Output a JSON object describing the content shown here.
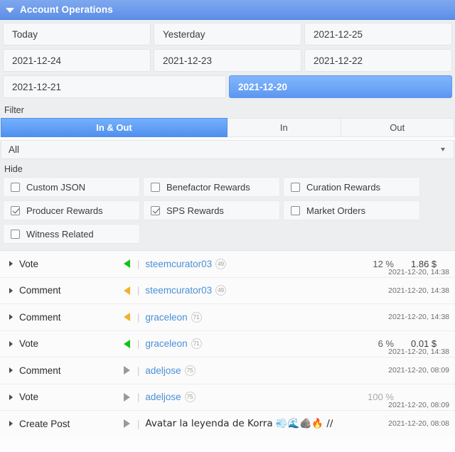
{
  "header": {
    "title": "Account Operations",
    "caret_icon": "caret-down-icon",
    "bg_color": "#6e9cec"
  },
  "dates": {
    "rows": [
      [
        {
          "label": "Today",
          "selected": false
        },
        {
          "label": "Yesterday",
          "selected": false
        },
        {
          "label": "2021-12-25",
          "selected": false
        }
      ],
      [
        {
          "label": "2021-12-24",
          "selected": false
        },
        {
          "label": "2021-12-23",
          "selected": false
        },
        {
          "label": "2021-12-22",
          "selected": false
        }
      ],
      [
        {
          "label": "2021-12-21",
          "selected": false
        },
        {
          "label": "2021-12-20",
          "selected": true
        }
      ]
    ]
  },
  "filter": {
    "label": "Filter",
    "segments": [
      {
        "label": "In & Out",
        "active": true
      },
      {
        "label": "In",
        "active": false
      },
      {
        "label": "Out",
        "active": false
      }
    ],
    "select": {
      "value": "All",
      "arrow_icon": "caret-down-icon"
    }
  },
  "hide": {
    "label": "Hide",
    "options": [
      {
        "label": "Custom JSON",
        "checked": false
      },
      {
        "label": "Benefactor Rewards",
        "checked": false
      },
      {
        "label": "Curation Rewards",
        "checked": false
      },
      {
        "label": "Producer Rewards",
        "checked": true
      },
      {
        "label": "SPS Rewards",
        "checked": true
      },
      {
        "label": "Market Orders",
        "checked": false
      },
      {
        "label": "Witness Related",
        "checked": false
      }
    ]
  },
  "operations": [
    {
      "type": "Vote",
      "direction": "in",
      "direction_color": "#15c215",
      "user": "steemcurator03",
      "reputation": "49",
      "percent": "12 %",
      "percent_muted": false,
      "amount": "1.86 $",
      "date": "2021-12-20, 14:38",
      "date_pos": "low"
    },
    {
      "type": "Comment",
      "direction": "in",
      "direction_color": "#f2b22e",
      "user": "steemcurator03",
      "reputation": "49",
      "percent": "",
      "percent_muted": false,
      "amount": "",
      "date": "2021-12-20, 14:38",
      "date_pos": "mid"
    },
    {
      "type": "Comment",
      "direction": "in",
      "direction_color": "#f2b22e",
      "user": "graceleon",
      "reputation": "71",
      "percent": "",
      "percent_muted": false,
      "amount": "",
      "date": "2021-12-20, 14:38",
      "date_pos": "mid"
    },
    {
      "type": "Vote",
      "direction": "in",
      "direction_color": "#15c215",
      "user": "graceleon",
      "reputation": "71",
      "percent": "6 %",
      "percent_muted": false,
      "amount": "0.01 $",
      "date": "2021-12-20, 14:38",
      "date_pos": "low"
    },
    {
      "type": "Comment",
      "direction": "out",
      "direction_color": "#9a9a9a",
      "user": "adeljose",
      "reputation": "75",
      "percent": "",
      "percent_muted": false,
      "amount": "",
      "date": "2021-12-20, 08:09",
      "date_pos": "mid"
    },
    {
      "type": "Vote",
      "direction": "out",
      "direction_color": "#9a9a9a",
      "user": "adeljose",
      "reputation": "75",
      "percent": "100 %",
      "percent_muted": true,
      "amount": "",
      "date": "2021-12-20, 08:09",
      "date_pos": "low"
    },
    {
      "type": "Create Post",
      "direction": "out",
      "direction_color": "#9a9a9a",
      "title": "Avatar la leyenda de Korra 💨🌊🪨🔥 // ...",
      "percent": "",
      "percent_muted": false,
      "amount": "",
      "date": "2021-12-20, 08:08",
      "date_pos": "mid"
    }
  ]
}
